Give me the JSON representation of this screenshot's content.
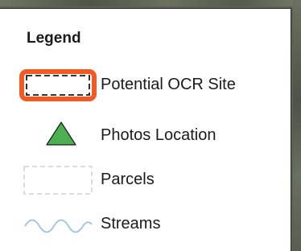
{
  "legend": {
    "title": "Legend",
    "items": [
      {
        "label": "Potential OCR Site",
        "symbol": "orange-outlined-dashed-rectangle",
        "color": "#f15a24"
      },
      {
        "label": "Photos Location",
        "symbol": "green-triangle-icon",
        "color": "#4caf50"
      },
      {
        "label": "Parcels",
        "symbol": "gray-dashed-rectangle",
        "color": "#c8c8c8"
      },
      {
        "label": "Streams",
        "symbol": "blue-wavy-line",
        "color": "#9cc3e6"
      }
    ]
  }
}
